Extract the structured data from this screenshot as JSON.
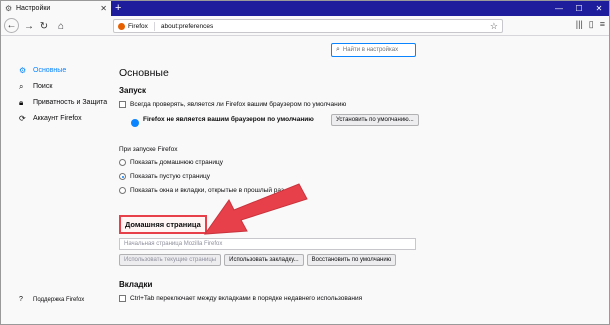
{
  "tab": {
    "title": "Настройки",
    "icon": "gear-icon"
  },
  "toolbar": {
    "url_label": "Firefox",
    "url": "about:preferences"
  },
  "search": {
    "placeholder": "Найти в настройках"
  },
  "sidebar": {
    "items": [
      {
        "label": "Основные",
        "icon": "gear-icon",
        "active": true
      },
      {
        "label": "Поиск",
        "icon": "search-icon",
        "active": false
      },
      {
        "label": "Приватность и Защита",
        "icon": "lock-icon",
        "active": false
      },
      {
        "label": "Аккаунт Firefox",
        "icon": "sync-icon",
        "active": false
      }
    ],
    "support": "Поддержка Firefox"
  },
  "main": {
    "title": "Основные",
    "startup": {
      "heading": "Запуск",
      "always_check": "Всегда проверять, является ли Firefox вашим браузером по умолчанию",
      "not_default": "Firefox не является вашим браузером по умолчанию",
      "set_default_button": "Установить по умолчанию..."
    },
    "on_start": {
      "label": "При запуске Firefox",
      "options": [
        {
          "label": "Показать домашнюю страницу",
          "selected": false
        },
        {
          "label": "Показать пустую страницу",
          "selected": true
        },
        {
          "label": "Показать окна и вкладки, открытые в прошлый раз",
          "selected": false
        }
      ]
    },
    "homepage": {
      "title": "Домашняя страница",
      "placeholder": "Начальная страница Mozilla Firefox",
      "buttons": {
        "use_current": "Использовать текущие страницы",
        "use_bookmark": "Использовать закладку...",
        "restore": "Восстановить по умолчанию"
      }
    },
    "tabs": {
      "heading": "Вкладки",
      "ctrl_tab": "Ctrl+Tab переключает между вкладками в порядке недавнего использования"
    }
  },
  "colors": {
    "accent": "#0a84ff",
    "arrow": "#e8404a",
    "tabstrip": "#1e1e9c"
  }
}
